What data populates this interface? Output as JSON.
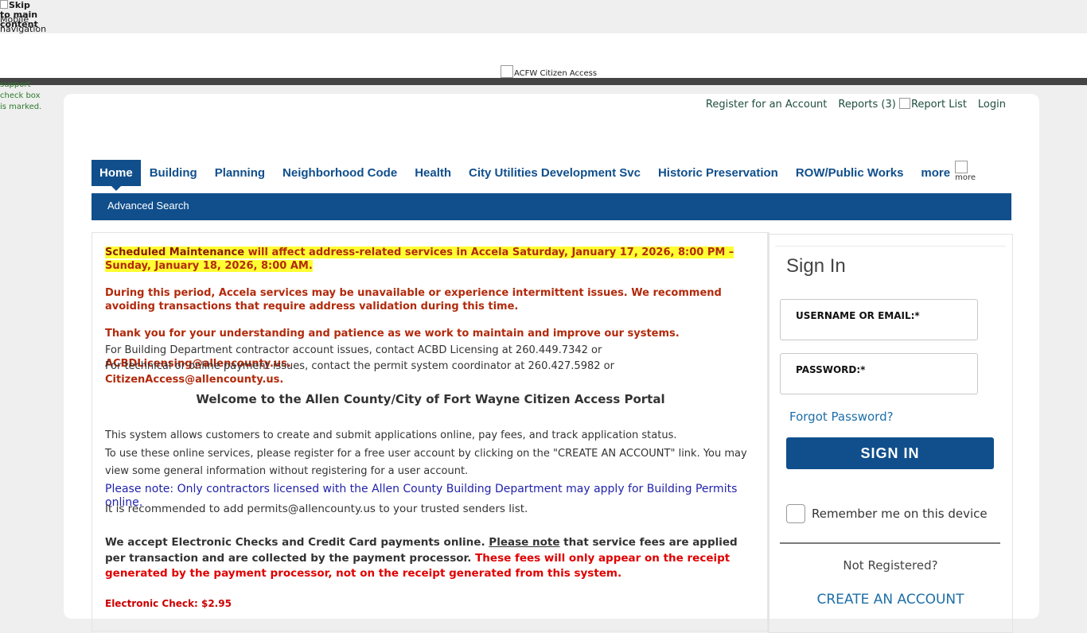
{
  "header": {
    "skip_link": "Skip to main content",
    "mobile_nav": "Mobile navigation",
    "logo_alt": "ACFW Citizen Access",
    "green_note": "support check box is marked."
  },
  "top_links": {
    "register": "Register for an Account",
    "reports": "Reports (3)",
    "report_list": "Report List",
    "login": "Login"
  },
  "tabs": [
    "Home",
    "Building",
    "Planning",
    "Neighborhood Code",
    "Health",
    "City Utilities Development Svc",
    "Historic Preservation",
    "ROW/Public Works",
    "more"
  ],
  "more_icon_alt": "more",
  "subnav": {
    "advanced_search": "Advanced Search"
  },
  "notice": {
    "maint_label": "Scheduled Maintenance",
    "maint_text": " will affect address-related services in Accela Saturday, January 17, 2026, 8:00 PM – Sunday, January 18, 2026, 8:00 AM.",
    "period": "During this period, Accela services may be unavailable or experience intermittent issues. We recommend avoiding transactions that require address validation during this time.",
    "thanks": "Thank you for your understanding and patience as we work to maintain and improve our systems.",
    "building_contact_text": "For Building Department contractor account issues, contact ACBD Licensing at 260.449.7342 or ",
    "building_email": "ACBDLicensing@allencounty.us.",
    "tech_contact_text": "For technical or online payment issues, contact the permit system coordinator at 260.427.5982 or ",
    "tech_email": "CitizenAccess@allencounty.us."
  },
  "welcome": {
    "title": "Welcome to the Allen County/City of Fort Wayne Citizen Access Portal",
    "p1": "This system allows customers to create and submit applications online, pay fees, and track application status.",
    "p2": "To use these online services, please register for a free user account by clicking on the \"CREATE AN ACCOUNT\" link. You may view some general information without registering for a user account.",
    "note": "Please note: Only contractors licensed with the Allen County Building Department may apply for Building Permits online.",
    "recommend": "It is recommended to add permits@allencounty.us to your trusted senders list.",
    "payments_1": "We accept Electronic Checks and Credit Card payments online. ",
    "payments_note": "Please note",
    "payments_2": " that service fees are applied per transaction and are collected by the payment processor. ",
    "payments_red": "These fees will only appear on the receipt generated by the payment processor, not on the receipt generated from this system.",
    "echeck": "Electronic Check: $2.95"
  },
  "signin": {
    "title": "Sign In",
    "username_label": "USERNAME OR EMAIL:*",
    "password_label": "PASSWORD:*",
    "forgot": "Forgot Password?",
    "button": "SIGN IN",
    "remember": "Remember me on this device",
    "not_registered": "Not Registered?",
    "create": "CREATE AN ACCOUNT"
  }
}
